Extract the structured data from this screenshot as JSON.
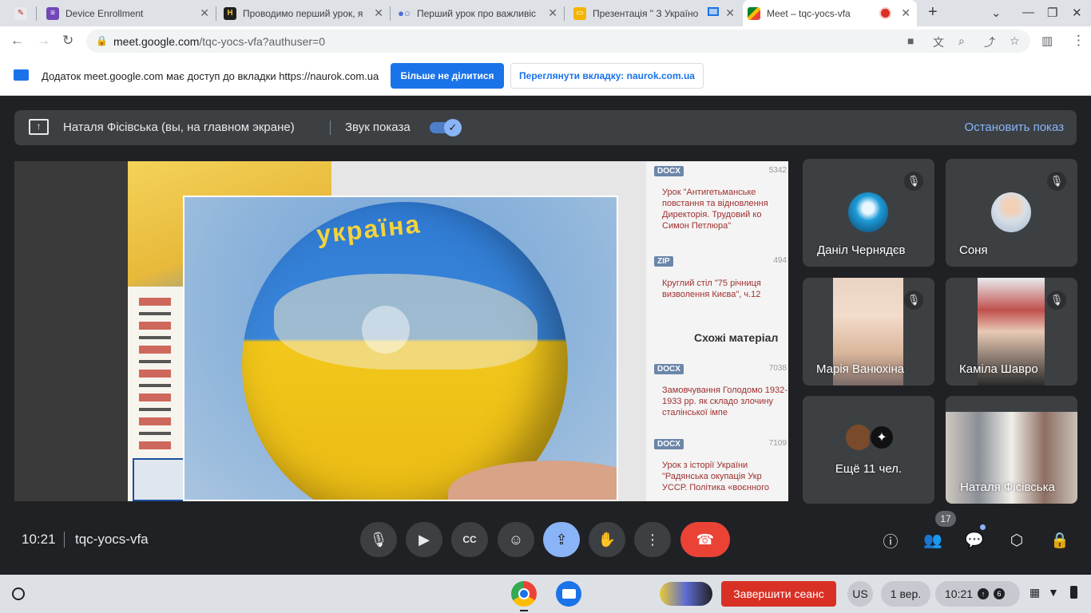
{
  "browser": {
    "tabs": [
      {
        "title": "",
        "favicon": "crossed-pencil-icon"
      },
      {
        "title": "Device Enrollment",
        "favicon": "form-icon",
        "color": "#7248b9"
      },
      {
        "title": "Проводимо перший урок, я",
        "favicon": "h-logo-icon",
        "color": "#1f1f1f"
      },
      {
        "title": "Перший урок про важливіс",
        "favicon": "naurok-icon",
        "color": "#4d6bd9"
      },
      {
        "title": "Презентація \" З Україно",
        "favicon": "slides-icon",
        "color": "#f4b400"
      },
      {
        "title": "Meet – tqc-yocs-vfa",
        "favicon": "meet-icon",
        "active": true
      }
    ],
    "url_host": "meet.google.com",
    "url_path": "/tqc-yocs-vfa?authuser=0"
  },
  "infobar": {
    "text": "Додаток meet.google.com має доступ до вкладки https://naurok.com.ua",
    "stop_sharing": "Більше не ділитися",
    "view_tab": "Переглянути вкладку: naurok.com.ua"
  },
  "presenting": {
    "name": "Наталя Фісівська (вы, на главном экране)",
    "sound_label": "Звук показа",
    "sound_on": true,
    "stop": "Остановить показ"
  },
  "shared_screen": {
    "photo_title": "україна",
    "similar": "Схожі матеріал",
    "materials": [
      {
        "badge": "DOCX",
        "views": "5342",
        "text": "Урок \"Антигетьманське повстання та відновлення Директорія. Трудовий ко Симон Петлюра\""
      },
      {
        "badge": "ZIP",
        "views": "494",
        "text": "Круглий стіл \"75 річниця визволення Києва\", ч.12"
      },
      {
        "badge": "DOCX",
        "views": "7038",
        "text": "Замовчування Голодомо 1932-1933 рр. як складо злочину сталінської імпе"
      },
      {
        "badge": "DOCX",
        "views": "7109",
        "text": "Урок з історії України \"Радянська окупація Укр УССР. Політика «воєнного"
      }
    ]
  },
  "participants": [
    {
      "name": "Даніл Чернядєв",
      "muted": true
    },
    {
      "name": "Соня",
      "muted": true
    },
    {
      "name": "Марія Ванюхіна",
      "muted": true
    },
    {
      "name": "Каміла Шавро",
      "muted": true
    },
    {
      "name": "Ещё 11 чел."
    },
    {
      "name": "Наталя Фісівська"
    }
  ],
  "bottom": {
    "time": "10:21",
    "code": "tqc-yocs-vfa",
    "people_count": "17"
  },
  "shelf": {
    "end_session": "Завершити сеанс",
    "keyboard": "US",
    "date": "1 вер.",
    "time": "10:21",
    "notification_count": "6"
  },
  "colors": {
    "meet_bg": "#202124",
    "accent_blue": "#1a73e8",
    "end_call_red": "#ea4335",
    "present_on": "#8ab4f8"
  }
}
